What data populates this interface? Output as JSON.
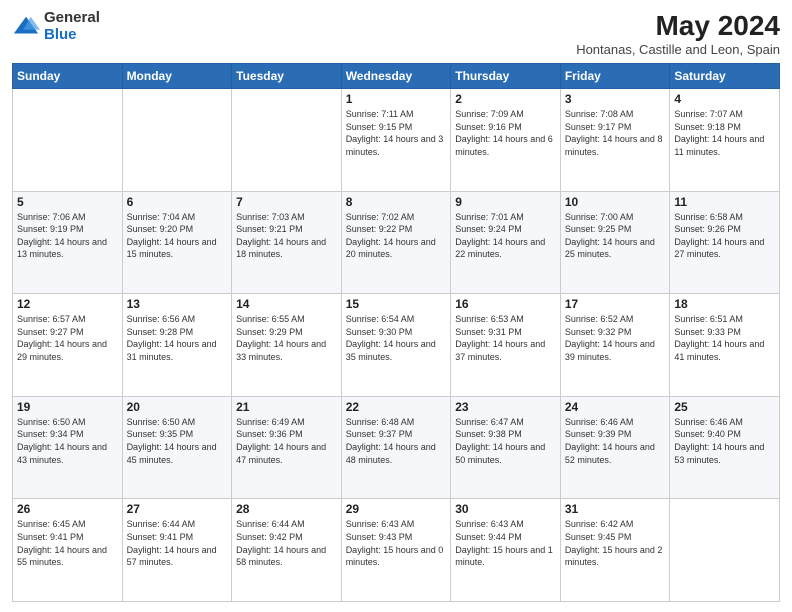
{
  "header": {
    "logo_general": "General",
    "logo_blue": "Blue",
    "title": "May 2024",
    "subtitle": "Hontanas, Castille and Leon, Spain"
  },
  "weekdays": [
    "Sunday",
    "Monday",
    "Tuesday",
    "Wednesday",
    "Thursday",
    "Friday",
    "Saturday"
  ],
  "weeks": [
    [
      {
        "day": "",
        "info": ""
      },
      {
        "day": "",
        "info": ""
      },
      {
        "day": "",
        "info": ""
      },
      {
        "day": "1",
        "info": "Sunrise: 7:11 AM\nSunset: 9:15 PM\nDaylight: 14 hours and 3 minutes."
      },
      {
        "day": "2",
        "info": "Sunrise: 7:09 AM\nSunset: 9:16 PM\nDaylight: 14 hours and 6 minutes."
      },
      {
        "day": "3",
        "info": "Sunrise: 7:08 AM\nSunset: 9:17 PM\nDaylight: 14 hours and 8 minutes."
      },
      {
        "day": "4",
        "info": "Sunrise: 7:07 AM\nSunset: 9:18 PM\nDaylight: 14 hours and 11 minutes."
      }
    ],
    [
      {
        "day": "5",
        "info": "Sunrise: 7:06 AM\nSunset: 9:19 PM\nDaylight: 14 hours and 13 minutes."
      },
      {
        "day": "6",
        "info": "Sunrise: 7:04 AM\nSunset: 9:20 PM\nDaylight: 14 hours and 15 minutes."
      },
      {
        "day": "7",
        "info": "Sunrise: 7:03 AM\nSunset: 9:21 PM\nDaylight: 14 hours and 18 minutes."
      },
      {
        "day": "8",
        "info": "Sunrise: 7:02 AM\nSunset: 9:22 PM\nDaylight: 14 hours and 20 minutes."
      },
      {
        "day": "9",
        "info": "Sunrise: 7:01 AM\nSunset: 9:24 PM\nDaylight: 14 hours and 22 minutes."
      },
      {
        "day": "10",
        "info": "Sunrise: 7:00 AM\nSunset: 9:25 PM\nDaylight: 14 hours and 25 minutes."
      },
      {
        "day": "11",
        "info": "Sunrise: 6:58 AM\nSunset: 9:26 PM\nDaylight: 14 hours and 27 minutes."
      }
    ],
    [
      {
        "day": "12",
        "info": "Sunrise: 6:57 AM\nSunset: 9:27 PM\nDaylight: 14 hours and 29 minutes."
      },
      {
        "day": "13",
        "info": "Sunrise: 6:56 AM\nSunset: 9:28 PM\nDaylight: 14 hours and 31 minutes."
      },
      {
        "day": "14",
        "info": "Sunrise: 6:55 AM\nSunset: 9:29 PM\nDaylight: 14 hours and 33 minutes."
      },
      {
        "day": "15",
        "info": "Sunrise: 6:54 AM\nSunset: 9:30 PM\nDaylight: 14 hours and 35 minutes."
      },
      {
        "day": "16",
        "info": "Sunrise: 6:53 AM\nSunset: 9:31 PM\nDaylight: 14 hours and 37 minutes."
      },
      {
        "day": "17",
        "info": "Sunrise: 6:52 AM\nSunset: 9:32 PM\nDaylight: 14 hours and 39 minutes."
      },
      {
        "day": "18",
        "info": "Sunrise: 6:51 AM\nSunset: 9:33 PM\nDaylight: 14 hours and 41 minutes."
      }
    ],
    [
      {
        "day": "19",
        "info": "Sunrise: 6:50 AM\nSunset: 9:34 PM\nDaylight: 14 hours and 43 minutes."
      },
      {
        "day": "20",
        "info": "Sunrise: 6:50 AM\nSunset: 9:35 PM\nDaylight: 14 hours and 45 minutes."
      },
      {
        "day": "21",
        "info": "Sunrise: 6:49 AM\nSunset: 9:36 PM\nDaylight: 14 hours and 47 minutes."
      },
      {
        "day": "22",
        "info": "Sunrise: 6:48 AM\nSunset: 9:37 PM\nDaylight: 14 hours and 48 minutes."
      },
      {
        "day": "23",
        "info": "Sunrise: 6:47 AM\nSunset: 9:38 PM\nDaylight: 14 hours and 50 minutes."
      },
      {
        "day": "24",
        "info": "Sunrise: 6:46 AM\nSunset: 9:39 PM\nDaylight: 14 hours and 52 minutes."
      },
      {
        "day": "25",
        "info": "Sunrise: 6:46 AM\nSunset: 9:40 PM\nDaylight: 14 hours and 53 minutes."
      }
    ],
    [
      {
        "day": "26",
        "info": "Sunrise: 6:45 AM\nSunset: 9:41 PM\nDaylight: 14 hours and 55 minutes."
      },
      {
        "day": "27",
        "info": "Sunrise: 6:44 AM\nSunset: 9:41 PM\nDaylight: 14 hours and 57 minutes."
      },
      {
        "day": "28",
        "info": "Sunrise: 6:44 AM\nSunset: 9:42 PM\nDaylight: 14 hours and 58 minutes."
      },
      {
        "day": "29",
        "info": "Sunrise: 6:43 AM\nSunset: 9:43 PM\nDaylight: 15 hours and 0 minutes."
      },
      {
        "day": "30",
        "info": "Sunrise: 6:43 AM\nSunset: 9:44 PM\nDaylight: 15 hours and 1 minute."
      },
      {
        "day": "31",
        "info": "Sunrise: 6:42 AM\nSunset: 9:45 PM\nDaylight: 15 hours and 2 minutes."
      },
      {
        "day": "",
        "info": ""
      }
    ]
  ]
}
